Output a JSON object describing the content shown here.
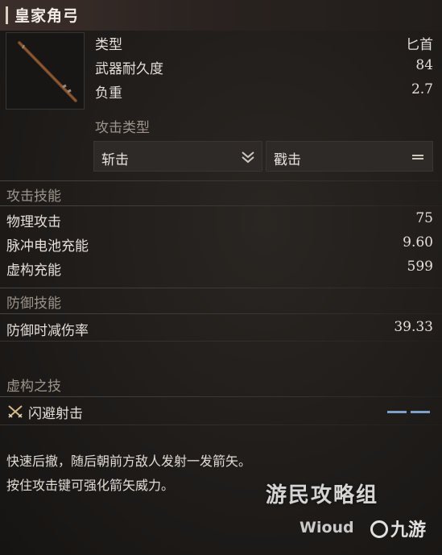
{
  "item": {
    "title": "皇家角弓",
    "type_label": "类型",
    "type_value": "匕首",
    "durability_label": "武器耐久度",
    "durability_value": "84",
    "weight_label": "负重",
    "weight_value": "2.7"
  },
  "attack_type": {
    "label": "攻击类型",
    "option1": "斩击",
    "option2": "戳击"
  },
  "attack_skill": {
    "heading": "攻击技能",
    "rows": [
      {
        "label": "物理攻击",
        "value": "75"
      },
      {
        "label": "脉冲电池充能",
        "value": "9.60"
      },
      {
        "label": "虚构充能",
        "value": "599"
      }
    ]
  },
  "defense_skill": {
    "heading": "防御技能",
    "rows": [
      {
        "label": "防御时减伤率",
        "value": "39.33"
      }
    ]
  },
  "fable_art": {
    "heading": "虚构之技",
    "name": "闪避射击",
    "segments_filled": 2,
    "icon": "crossed-arrows-icon",
    "accent": "#7fa0c8"
  },
  "description": {
    "line1": "快速后撤，随后朝前方敌人发射一发箭矢。",
    "line2": "按住攻击键可强化箭矢威力。"
  },
  "watermark": {
    "site": "游民攻略组",
    "author": "Wioud",
    "logo": "九游"
  }
}
